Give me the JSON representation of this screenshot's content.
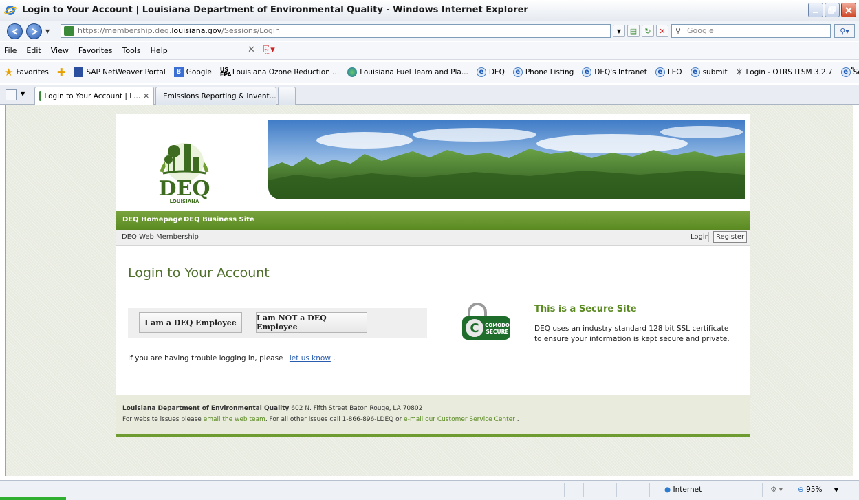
{
  "window": {
    "title": "Login to Your Account | Louisiana Department of Environmental Quality - Windows Internet Explorer"
  },
  "address": {
    "url_prefix": "https://membership.deq.",
    "url_domain": "louisiana.gov",
    "url_suffix": "/Sessions/Login",
    "search_placeholder": "Google"
  },
  "menu": [
    "File",
    "Edit",
    "View",
    "Favorites",
    "Tools",
    "Help"
  ],
  "favorites": {
    "label": "Favorites",
    "items": [
      "SAP NetWeaver Portal",
      "Google",
      "Louisiana Ozone Reduction ...",
      "Louisiana Fuel Team and Pla...",
      "DEQ",
      "Phone Listing",
      "DEQ's Intranet",
      "LEO",
      "submit",
      "Login - OTRS ITSM 3.2.7",
      "Search EDMS"
    ]
  },
  "tabs": [
    {
      "label": "Login to Your Account | L...",
      "active": true
    },
    {
      "label": "Emissions Reporting & Invent...",
      "active": false
    }
  ],
  "site": {
    "logo_text": "DEQ",
    "logo_sub": "LOUISIANA",
    "nav": [
      "DEQ Homepage",
      "DEQ Business Site"
    ],
    "subbar": {
      "left": "DEQ Web Membership",
      "login": "Login",
      "register": "Register"
    },
    "heading": "Login to Your Account",
    "buttons": {
      "employee": "I am a DEQ Employee",
      "not_employee": "I am NOT a DEQ Employee"
    },
    "trouble": {
      "text": "If you are having trouble logging in, please",
      "link": "let us know",
      "end": "."
    },
    "badge": {
      "line1": "COMODO",
      "line2": "SECURE"
    },
    "secure": {
      "title": "This is a Secure Site",
      "text": "DEQ uses an industry standard 128 bit SSL certificate to ensure your information is kept secure and private."
    },
    "footer": {
      "org": "Louisiana Department of Environmental Quality",
      "address": " 602 N. Fifth Street Baton Rouge, LA 70802",
      "l2_a": "For website issues please ",
      "l2_link1": "email the web team",
      "l2_b": ".  For all other issues call 1-866-896-LDEQ or ",
      "l2_link2": "e-mail our Customer Service Center",
      "l2_c": " ."
    }
  },
  "status": {
    "zone": "Internet",
    "zoom": "95%"
  }
}
